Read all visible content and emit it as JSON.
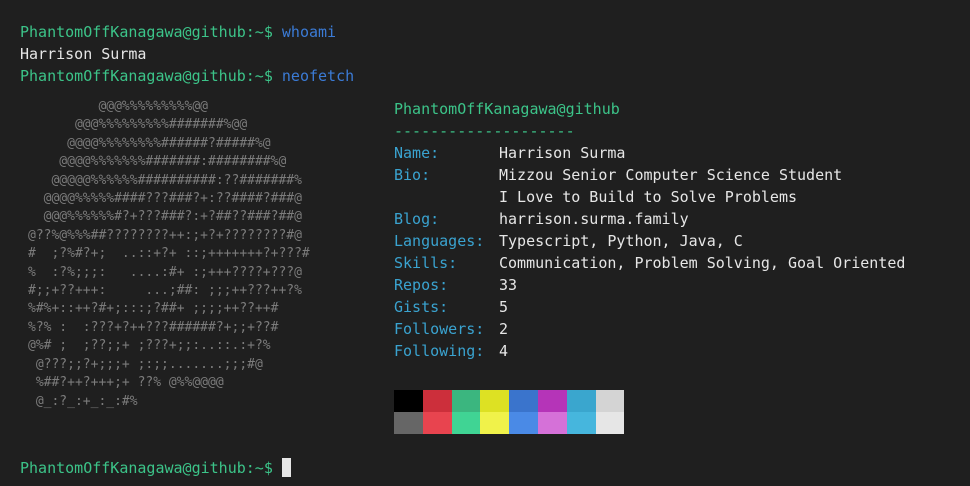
{
  "prompt": "PhantomOffKanagawa@github:~$",
  "history": [
    {
      "command": "whoami",
      "output": "Harrison Surma"
    },
    {
      "command": "neofetch"
    }
  ],
  "neofetch": {
    "ascii": [
      "         @@@%%%%%%%%%@@",
      "      @@@%%%%%%%%%#######%@@",
      "     @@@@%%%%%%%%######?#####%@",
      "    @@@@%%%%%%%#######:########%@",
      "   @@@@@%%%%%%##########:??#######%",
      "  @@@@%%%%%####???###?+:??####?###@",
      "  @@@%%%%%%#?+???###?:+?##??###?##@",
      "@??%@%%%##????????++:;+?+????????#@",
      "#  ;?%#?+;  ..::+?+ ::;+++++++?+???#",
      "%  :?%;;;:   ....:#+ :;+++????+???@",
      "#;;+??+++:     ...;##: ;;;++???++?%",
      "%#%+::++?#+;:::;?##+ ;;;;++??++#",
      "%?% :  :???+?++???######?+;;+??#",
      "@%# ;  ;??;;+ ;???+;;:..::.:+?%",
      " @???;;?+;;;+ ;:;;.......;;;#@",
      " %##?++?+++;+ ??% @%%@@@@",
      " @_:?_:+_:_:#%"
    ],
    "title": "PhantomOffKanagawa@github",
    "separator": "--------------------",
    "fields": [
      {
        "key": "Name:",
        "value": "Harrison Surma"
      },
      {
        "key": "Bio:",
        "value": "Mizzou Senior Computer Science Student"
      },
      {
        "key": "",
        "value": "I Love to Build to Solve Problems"
      },
      {
        "key": "Blog:",
        "value": "harrison.surma.family"
      },
      {
        "key": "Languages:",
        "value": "Typescript, Python, Java, C"
      },
      {
        "key": "Skills:",
        "value": "Communication, Problem Solving, Goal Oriented"
      },
      {
        "key": "Repos:",
        "value": "33"
      },
      {
        "key": "Gists:",
        "value": "5"
      },
      {
        "key": "Followers:",
        "value": "2"
      },
      {
        "key": "Following:",
        "value": "4"
      }
    ],
    "palette": [
      [
        "#000000",
        "#cc2f3b",
        "#3bb67f",
        "#dde123",
        "#3a74cc",
        "#b534b8",
        "#3aa6ce",
        "#d4d4d4"
      ],
      [
        "#666666",
        "#e8444f",
        "#40d494",
        "#f0f24a",
        "#4a8ae6",
        "#d571d8",
        "#46b6dd",
        "#e6e6e6"
      ]
    ]
  },
  "colors": {
    "background": "#1f1f1f",
    "prompt": "#3cc489",
    "command": "#3b7bd6",
    "key": "#3aa3d0",
    "ascii": "#7c7c7c"
  }
}
